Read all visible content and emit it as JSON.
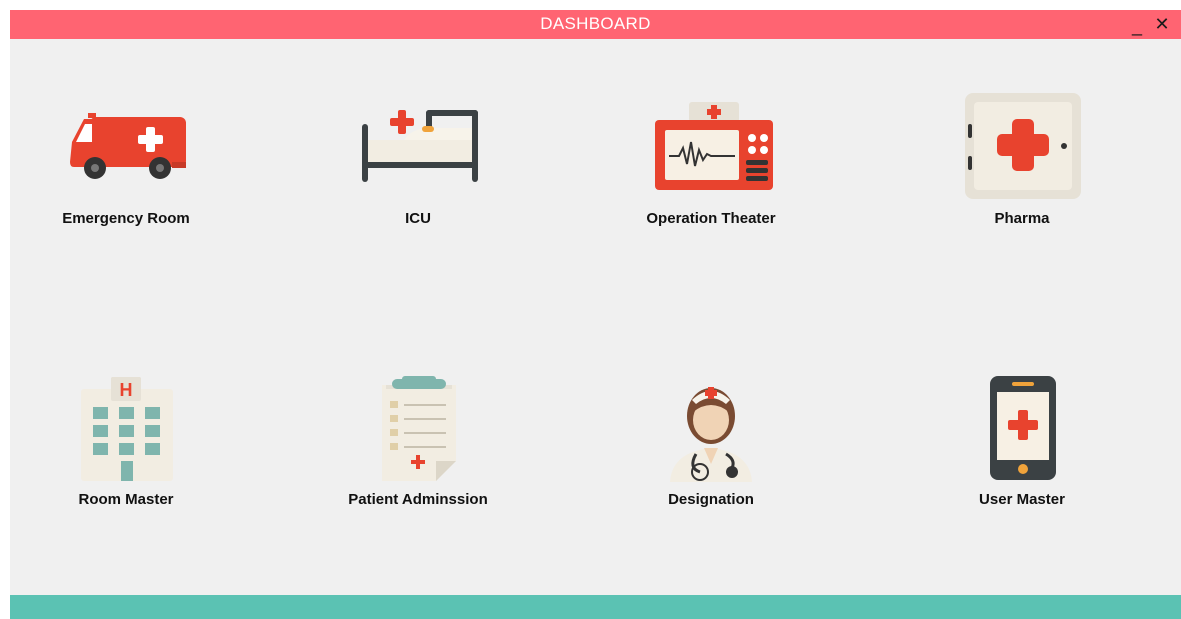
{
  "window": {
    "title": "DASHBOARD",
    "minimize_label": "_",
    "close_label": "✕",
    "colors": {
      "titlebar": "#ff6472",
      "footer": "#5bc2b3",
      "background": "#f0f0f0"
    }
  },
  "tiles": [
    {
      "label": "Emergency Room",
      "icon": "ambulance-icon"
    },
    {
      "label": "ICU",
      "icon": "hospital-bed-icon"
    },
    {
      "label": "Operation Theater",
      "icon": "heart-monitor-icon"
    },
    {
      "label": "Pharma",
      "icon": "medicine-cabinet-icon"
    },
    {
      "label": "Room Master",
      "icon": "hospital-building-icon"
    },
    {
      "label": "Patient Adminssion",
      "icon": "clipboard-icon"
    },
    {
      "label": "Designation",
      "icon": "nurse-icon"
    },
    {
      "label": "User Master",
      "icon": "mobile-phone-icon"
    }
  ]
}
